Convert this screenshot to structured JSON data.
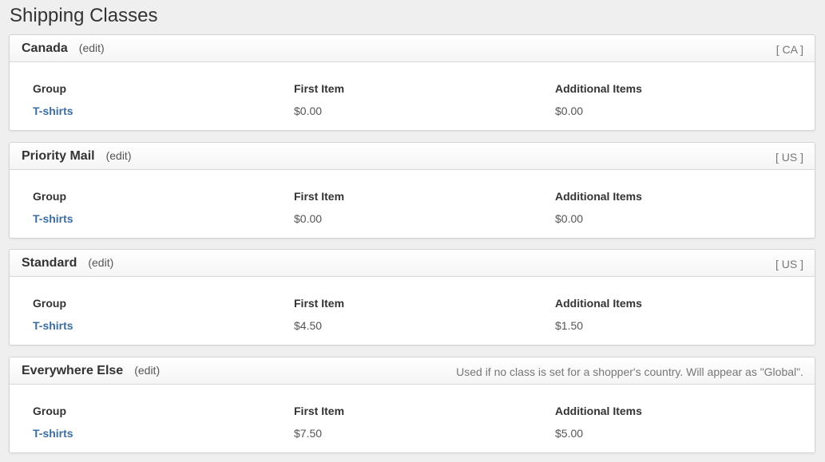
{
  "page": {
    "title": "Shipping Classes"
  },
  "panels": [
    {
      "name": "Canada",
      "edit_label": "(edit)",
      "meta": "[ CA ]",
      "columns": [
        "Group",
        "First Item",
        "Additional Items"
      ],
      "rows": [
        {
          "group": "T-shirts",
          "first_item": "$0.00",
          "additional_items": "$0.00"
        }
      ]
    },
    {
      "name": "Priority Mail",
      "edit_label": "(edit)",
      "meta": "[ US ]",
      "columns": [
        "Group",
        "First Item",
        "Additional Items"
      ],
      "rows": [
        {
          "group": "T-shirts",
          "first_item": "$0.00",
          "additional_items": "$0.00"
        }
      ]
    },
    {
      "name": "Standard",
      "edit_label": "(edit)",
      "meta": "[ US ]",
      "columns": [
        "Group",
        "First Item",
        "Additional Items"
      ],
      "rows": [
        {
          "group": "T-shirts",
          "first_item": "$4.50",
          "additional_items": "$1.50"
        }
      ]
    },
    {
      "name": "Everywhere Else",
      "edit_label": "(edit)",
      "meta": "Used if no class is set for a shopper's country. Will appear as \"Global\".",
      "columns": [
        "Group",
        "First Item",
        "Additional Items"
      ],
      "rows": [
        {
          "group": "T-shirts",
          "first_item": "$7.50",
          "additional_items": "$5.00"
        }
      ]
    }
  ],
  "colors": {
    "background": "#efefef",
    "link": "#3a6ea5",
    "text": "#333333",
    "muted": "#777777"
  }
}
